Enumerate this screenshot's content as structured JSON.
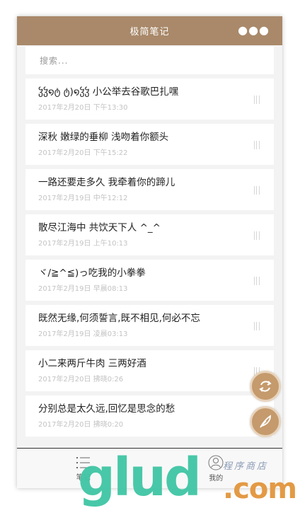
{
  "app": {
    "title": "极简笔记",
    "more": "●●●"
  },
  "search": {
    "placeholder": "搜索..."
  },
  "notes": [
    {
      "title": "ჴჴ໑ტ ტ)໑ჴჴ 小公举去谷歌巴扎嘿",
      "time": "2017年2月20日 下午13:30"
    },
    {
      "title": "深秋 嫩绿的垂柳 浅吻着你额头",
      "time": "2017年2月20日 下午15:22"
    },
    {
      "title": "一路还要走多久 我牵着你的蹄儿",
      "time": "2017年2月19日 中午12:12"
    },
    {
      "title": "散尽江海中 共饮天下人 ^_^",
      "time": "2017年2月19日 上午10:13"
    },
    {
      "title": "ヾ/≧^≦)っ吃我的小拳拳",
      "time": "2017年2月19日 早晨08:13"
    },
    {
      "title": "既然无缘,何须誓言,既不相见,何必不忘",
      "time": "2017年2月19日 凌晨03:13"
    },
    {
      "title": "小二来两斤牛肉 三两好酒",
      "time": "2017年2月20日 拂晓0:26"
    },
    {
      "title": "分别总是太久远,回忆是思念的愁",
      "time": "2017年2月20日 拂晓0:20"
    }
  ],
  "tabs": [
    {
      "label": "笔记",
      "icon": "list-icon"
    },
    {
      "label": "我的",
      "icon": "user-icon"
    }
  ],
  "fabs": {
    "refresh_icon": "refresh-icon",
    "compose_icon": "feather-icon"
  },
  "watermark": {
    "big": "glud",
    "com": ".com",
    "small": "程序商店"
  },
  "colors": {
    "accent": "#a9886a",
    "fab": "#c59a6c"
  }
}
